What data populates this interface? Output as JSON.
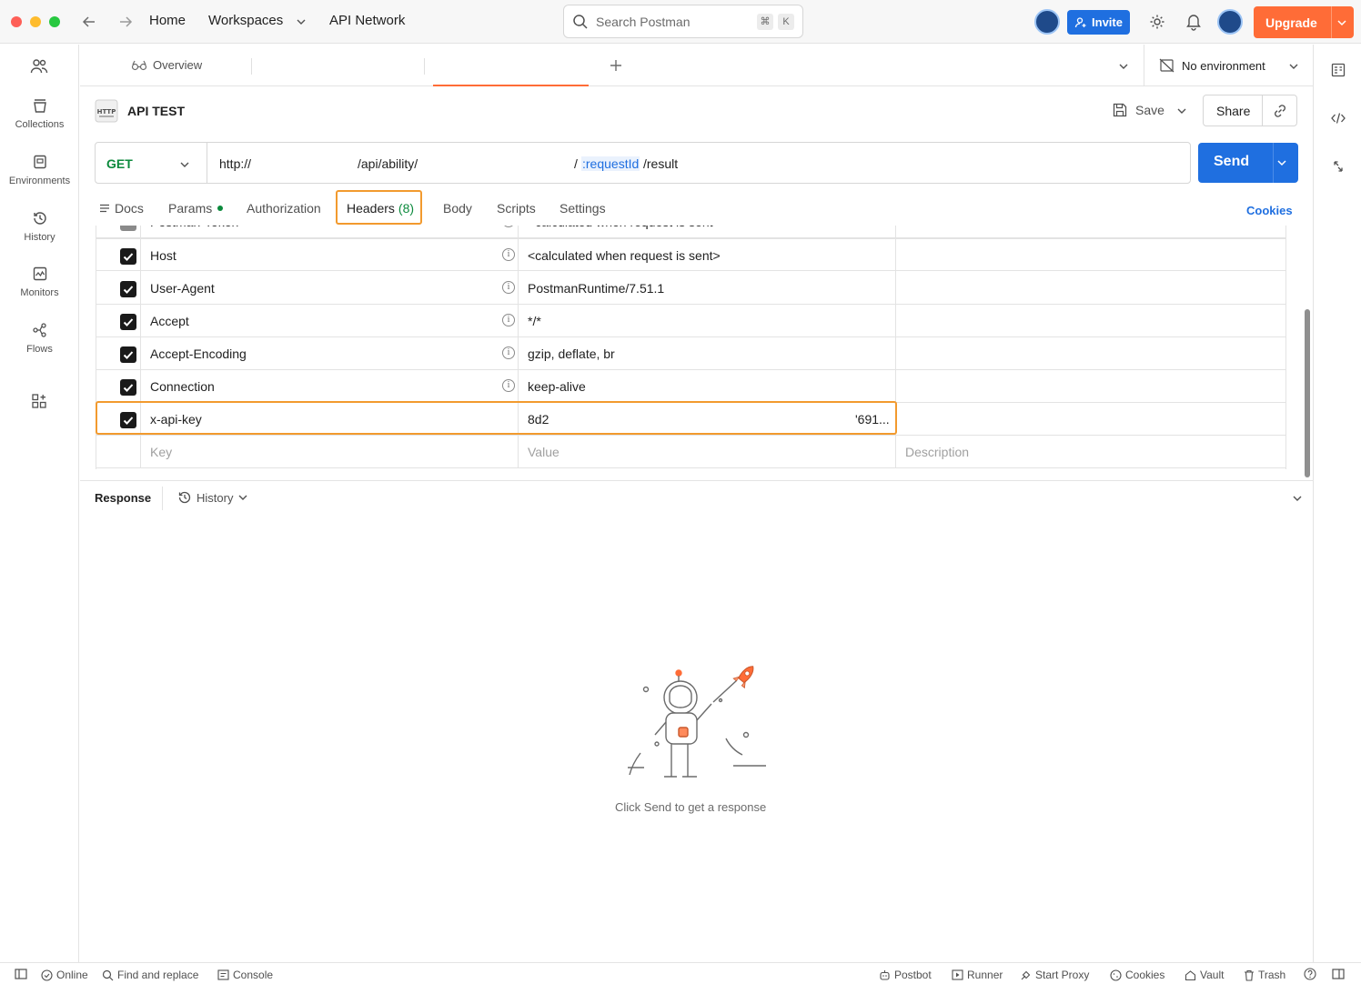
{
  "topbar": {
    "nav_links": [
      "Home",
      "Workspaces",
      "API Network"
    ],
    "search_placeholder": "Search Postman",
    "shortcut_keys": [
      "⌘",
      "K"
    ],
    "invite_label": "Invite",
    "upgrade_label": "Upgrade"
  },
  "sidebar": {
    "items": [
      {
        "label": "Collections",
        "icon": "collections-icon"
      },
      {
        "label": "Environments",
        "icon": "environments-icon"
      },
      {
        "label": "History",
        "icon": "history-icon"
      },
      {
        "label": "Monitors",
        "icon": "monitors-icon"
      },
      {
        "label": "Flows",
        "icon": "flows-icon"
      }
    ]
  },
  "tabs": {
    "overview_label": "Overview",
    "environment_label": "No environment"
  },
  "request": {
    "name": "API TEST",
    "save_label": "Save",
    "share_label": "Share",
    "method": "GET",
    "url_parts": [
      "http://",
      "/api/ability/",
      "/",
      ":requestId",
      "/result"
    ],
    "send_label": "Send"
  },
  "subtabs": {
    "docs": "Docs",
    "params": "Params",
    "authorization": "Authorization",
    "headers": "Headers",
    "headers_count": "(8)",
    "body": "Body",
    "scripts": "Scripts",
    "settings": "Settings",
    "cookies": "Cookies"
  },
  "headers_table": {
    "partial_row": {
      "key": "Postman-Token",
      "value": "<calculated when request is sent>"
    },
    "rows": [
      {
        "key": "Host",
        "value": "<calculated when request is sent>"
      },
      {
        "key": "User-Agent",
        "value": "PostmanRuntime/7.51.1"
      },
      {
        "key": "Accept",
        "value": "*/*"
      },
      {
        "key": "Accept-Encoding",
        "value": "gzip, deflate, br"
      },
      {
        "key": "Connection",
        "value": "keep-alive"
      },
      {
        "key": "x-api-key",
        "value": "8d2",
        "value_tail": "'691..."
      }
    ],
    "placeholders": {
      "key": "Key",
      "value": "Value",
      "description": "Description"
    }
  },
  "response": {
    "label": "Response",
    "history_label": "History",
    "empty_message": "Click Send to get a response"
  },
  "statusbar": {
    "left": [
      "Online",
      "Find and replace",
      "Console"
    ],
    "right": [
      "Postbot",
      "Runner",
      "Start Proxy",
      "Cookies",
      "Vault",
      "Trash"
    ]
  },
  "colors": {
    "accent_blue": "#1f6fe0",
    "upgrade_orange": "#ff6c37",
    "highlight_orange": "#f29a2e",
    "get_green": "#0b8a3c"
  }
}
